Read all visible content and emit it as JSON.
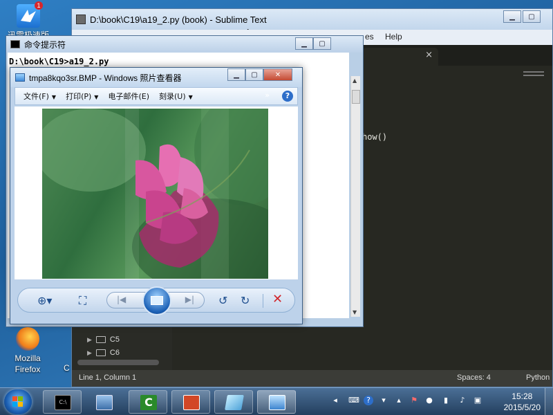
{
  "desktop": {
    "icons": [
      {
        "label_line1": "迅雷极速版",
        "badge": "1",
        "icon": "xunlei-bird-icon"
      },
      {
        "label_line1": "Mozilla",
        "label_line2": "Firefox",
        "icon": "firefox-icon"
      }
    ],
    "partial_label": "C"
  },
  "sublime": {
    "title": "D:\\book\\C19\\a19_2.py (book) - Sublime Text",
    "menu_partial": [
      "es",
      "Help"
    ],
    "code_fragment": "how()",
    "folders": [
      "C5",
      "C6"
    ],
    "status": {
      "position": "Line 1, Column 1",
      "spaces": "Spaces: 4",
      "syntax": "Python"
    }
  },
  "cmd": {
    "title": "命令提示符",
    "prompt": "D:\\book\\C19>a19_2.py"
  },
  "viewer": {
    "title": "tmpa8kqo3sr.BMP - Windows 照片查看器",
    "menu": [
      "文件(F)",
      "打印(P)",
      "电子邮件(E)",
      "刻录(U)"
    ],
    "help": "?",
    "controls": [
      "zoom-icon",
      "fit-icon",
      "previous-icon",
      "slideshow-icon",
      "next-icon",
      "rotate-left-icon",
      "rotate-right-icon",
      "delete-icon"
    ]
  },
  "taskbar": {
    "apps": [
      "cmd-icon",
      "virtualbox-icon",
      "camtasia-icon",
      "powerpoint-icon",
      "edit-icon",
      "photo-viewer-icon"
    ],
    "time": "15:28",
    "date": "2015/5/20"
  },
  "colors": {
    "accent": "#1a5fb5",
    "editor_bg": "#272822",
    "delete_red": "#d1252a"
  }
}
